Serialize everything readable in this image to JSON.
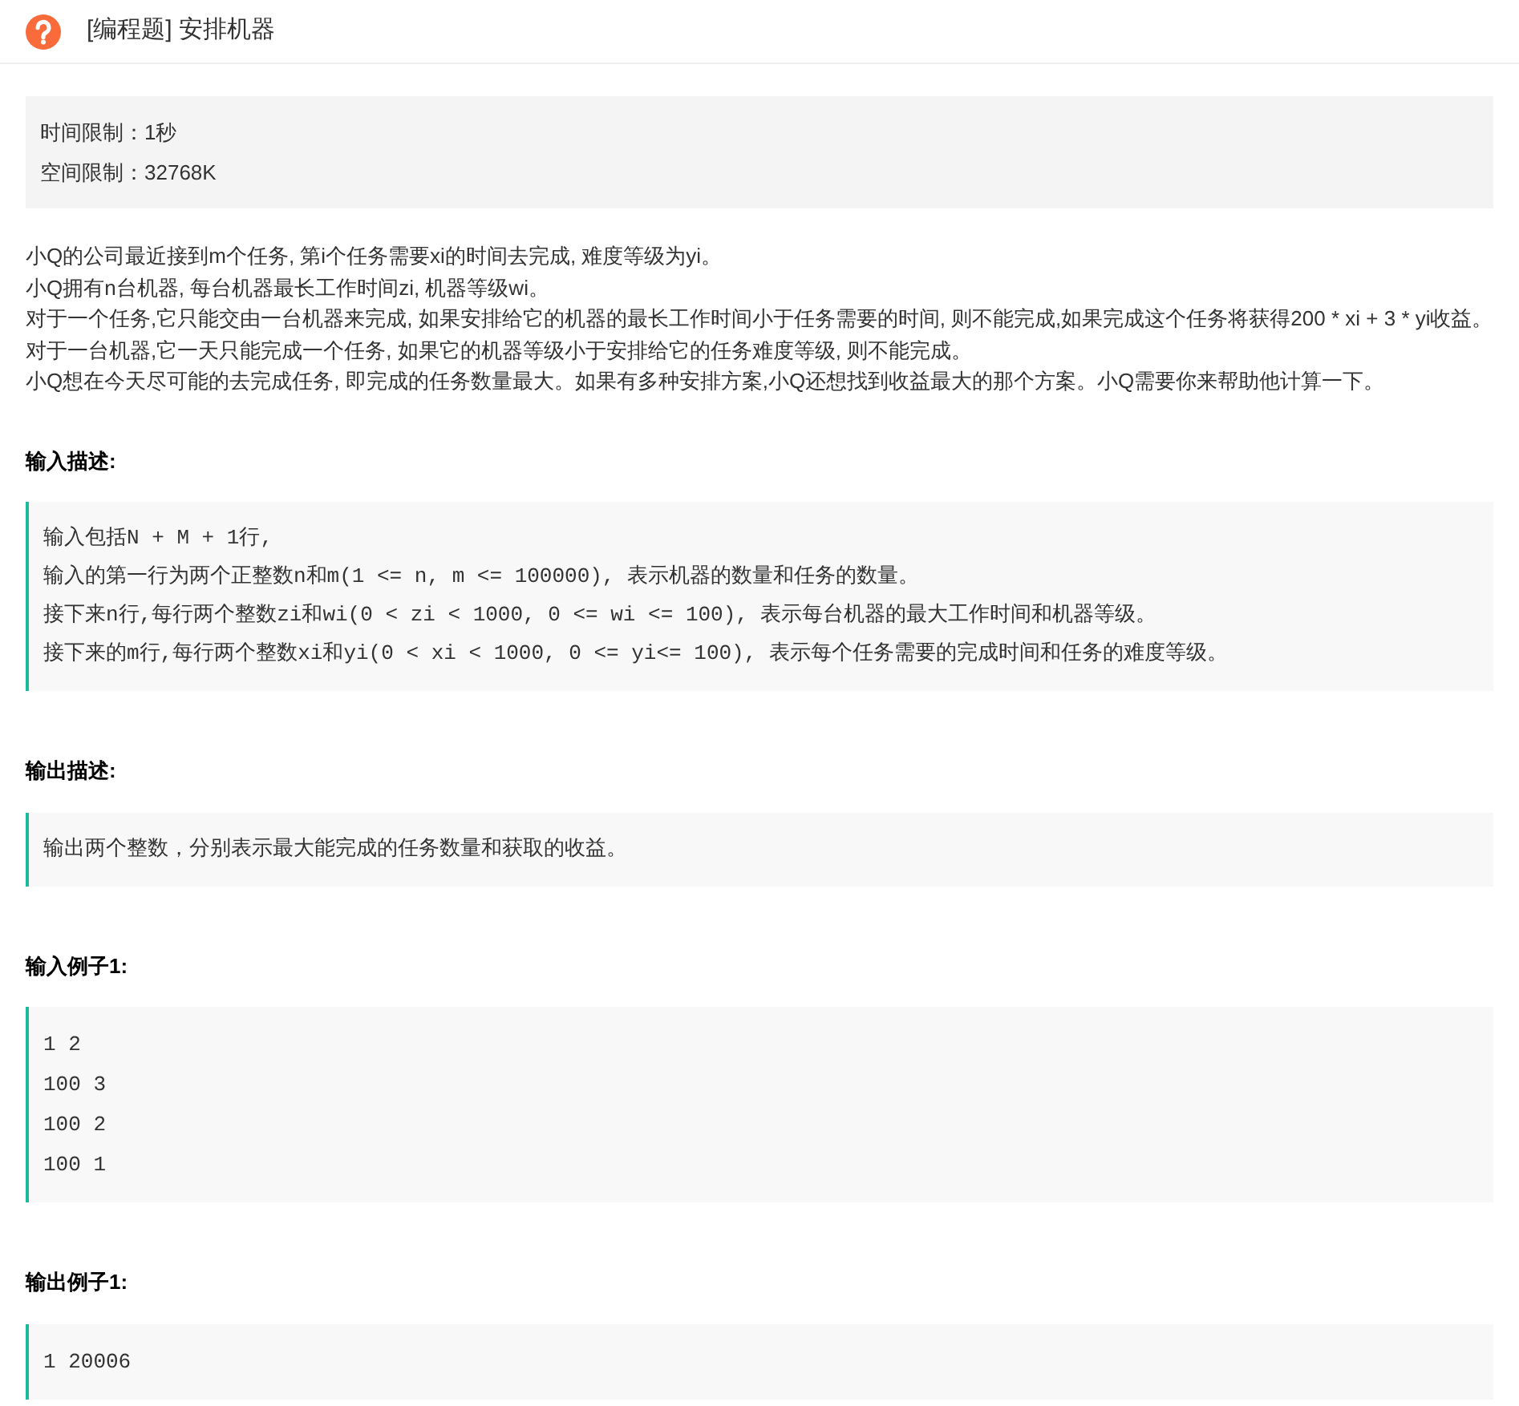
{
  "header": {
    "title": "[编程题] 安排机器"
  },
  "limits": [
    "时间限制：1秒",
    "空间限制：32768K"
  ],
  "description": [
    "小Q的公司最近接到m个任务, 第i个任务需要xi的时间去完成, 难度等级为yi。",
    "小Q拥有n台机器, 每台机器最长工作时间zi, 机器等级wi。",
    "对于一个任务,它只能交由一台机器来完成, 如果安排给它的机器的最长工作时间小于任务需要的时间, 则不能完成,如果完成这个任务将获得200 * xi + 3 * yi收益。",
    "对于一台机器,它一天只能完成一个任务, 如果它的机器等级小于安排给它的任务难度等级, 则不能完成。",
    "小Q想在今天尽可能的去完成任务, 即完成的任务数量最大。如果有多种安排方案,小Q还想找到收益最大的那个方案。小Q需要你来帮助他计算一下。"
  ],
  "sections": [
    {
      "heading": "输入描述:",
      "kind": "text",
      "lines": [
        "输入包括N + M + 1行,",
        "输入的第一行为两个正整数n和m(1 <= n, m <= 100000), 表示机器的数量和任务的数量。",
        "接下来n行,每行两个整数zi和wi(0 < zi < 1000, 0 <= wi <= 100), 表示每台机器的最大工作时间和机器等级。",
        "接下来的m行,每行两个整数xi和yi(0 < xi < 1000, 0 <= yi<= 100), 表示每个任务需要的完成时间和任务的难度等级。"
      ]
    },
    {
      "heading": "输出描述:",
      "kind": "text",
      "lines": [
        "输出两个整数，分别表示最大能完成的任务数量和获取的收益。"
      ]
    },
    {
      "heading": "输入例子1:",
      "kind": "code",
      "lines": [
        "1 2",
        "100 3",
        "100 2",
        "100 1"
      ]
    },
    {
      "heading": "输出例子1:",
      "kind": "code",
      "lines": [
        "1 20006"
      ]
    }
  ]
}
